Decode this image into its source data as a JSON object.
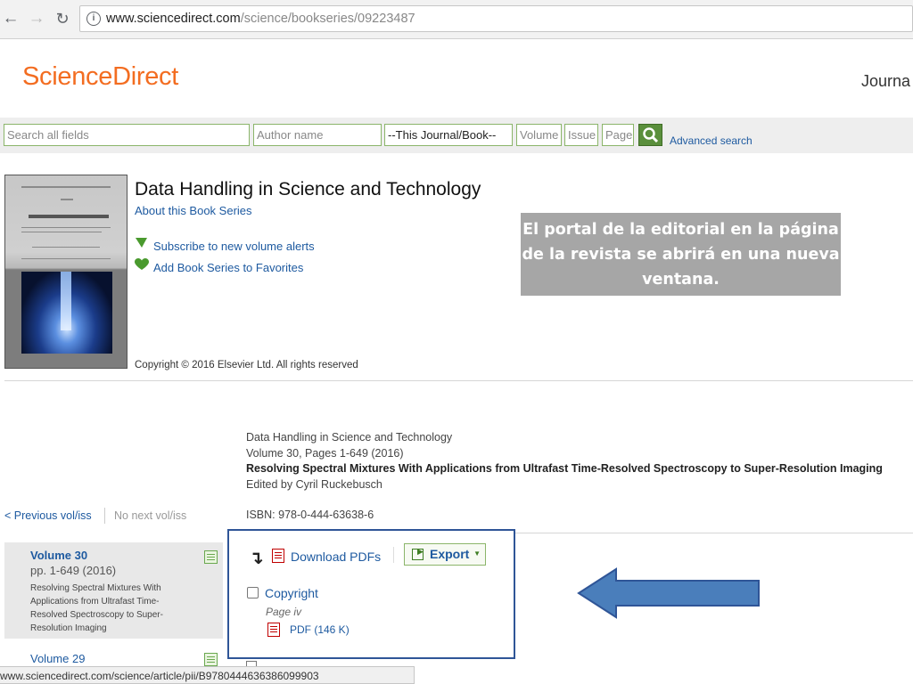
{
  "browser": {
    "url_domain": "www.sciencedirect.com",
    "url_path": "/science/bookseries/09223487"
  },
  "header": {
    "logo": "ScienceDirect",
    "nav_journals": "Journa"
  },
  "search": {
    "all_fields_placeholder": "Search all fields",
    "author_placeholder": "Author name",
    "journal_value": "--This Journal/Book--",
    "volume_placeholder": "Volume",
    "issue_placeholder": "Issue",
    "page_placeholder": "Page",
    "advanced_link": "Advanced search"
  },
  "series": {
    "title": "Data Handling in Science and Technology",
    "about_link": "About this Book Series",
    "subscribe_link": "Subscribe to new volume alerts",
    "favorites_link": "Add Book Series to Favorites",
    "copyright": "Copyright © 2016 Elsevier Ltd. All rights reserved"
  },
  "tooltip": {
    "text": "El portal de la editorial en la página de la revista se abrirá en una nueva ventana."
  },
  "volume_info": {
    "series": "Data Handling in Science and Technology",
    "volume_pages": "Volume 30, Pages 1-649 (2016)",
    "book_title": "Resolving Spectral Mixtures With Applications from Ultrafast Time-Resolved Spectroscopy to Super-Resolution Imaging",
    "editor": "Edited by Cyril Ruckebusch",
    "isbn": "ISBN: 978-0-444-63638-6"
  },
  "pager": {
    "prev": "< Previous vol/iss",
    "next": "No next vol/iss"
  },
  "volume_list": [
    {
      "label": "Volume 30",
      "pages": "pp. 1-649 (2016)",
      "desc": "Resolving Spectral Mixtures With Applications from Ultrafast Time-Resolved Spectroscopy to Super-Resolution Imaging"
    },
    {
      "label": "Volume 29"
    }
  ],
  "toc": {
    "download_pdfs": "Download PDFs",
    "export": "Export",
    "items": [
      {
        "title": "Copyright",
        "page": "Page iv",
        "pdf": "PDF (146 K)"
      }
    ]
  },
  "status_bar": {
    "text": "www.sciencedirect.com/science/article/pii/B9780444636386099903"
  },
  "colors": {
    "brand_orange": "#f36d21",
    "link_blue": "#1e5aa0",
    "highlight_border": "#2f5597",
    "arrow_fill": "#4a7ebb",
    "tooltip_bg": "#a6a6a6"
  }
}
